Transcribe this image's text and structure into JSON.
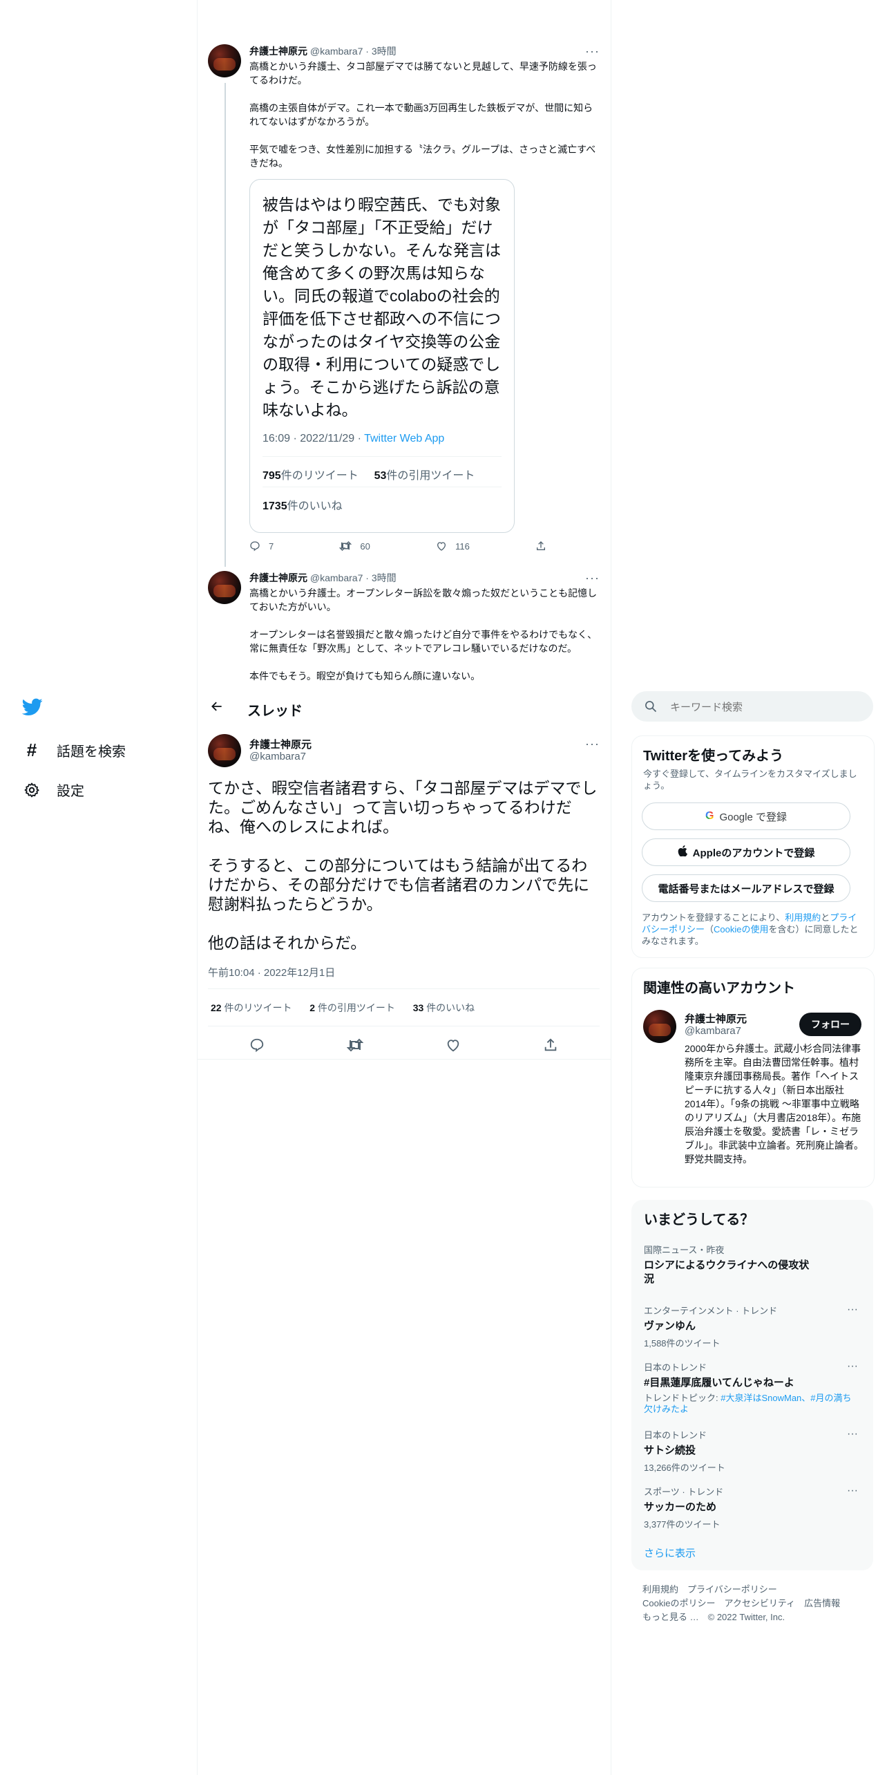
{
  "brand": {
    "accent": "#1d9bf0",
    "text": "#0f1419",
    "muted": "#536471",
    "icon": "twitter-bird-icon"
  },
  "nav": {
    "explore": "話題を検索",
    "settings": "設定"
  },
  "thread_header": {
    "title": "スレッド"
  },
  "tweet1": {
    "name": "弁護士神原元",
    "handle": "@kambara7",
    "sep": "·",
    "time": "3時間",
    "text": "高橋とかいう弁護士、タコ部屋デマでは勝てないと見越して、早速予防線を張ってるわけだ。\n\n高橋の主張自体がデマ。これ一本で動画3万回再生した鉄板デマが、世間に知られてないはずがなかろうが。\n\n平気で嘘をつき、女性差別に加担する〝法クラ〟グループは、さっさと滅亡すべきだね。",
    "quote": {
      "text": "被告はやはり暇空茜氏、でも対象が「タコ部屋」「不正受給」だけだと笑うしかない。そんな発言は俺含めて多くの野次馬は知らない。同氏の報道でcolaboの社会的評価を低下させ都政への不信につながったのはタイヤ交換等の公金の取得・利用についての疑惑でしょう。そこから逃げたら訴訟の意味ないよね。",
      "meta_time": "16:09 · 2022/11/29 · ",
      "meta_source": "Twitter Web App",
      "retweets_n": "795",
      "retweets_label": "件のリツイート",
      "quotes_n": "53",
      "quotes_label": "件の引用ツイート",
      "likes_n": "1735",
      "likes_label": "件のいいね"
    },
    "replies": "7",
    "retweets": "60",
    "likes": "116"
  },
  "tweet2": {
    "name": "弁護士神原元",
    "handle": "@kambara7",
    "sep": "·",
    "time": "3時間",
    "text": "高橋とかいう弁護士。オープンレター訴訟を散々煽った奴だということも記憶しておいた方がいい。\n\nオープンレターは名誉毀損だと散々煽ったけど自分で事件をやるわけでもなく、常に無責任な「野次馬」として、ネットでアレコレ騒いでいるだけなのだ。\n\n本件でもそう。暇空が負けても知らん顔に違いない。"
  },
  "main_tweet": {
    "name": "弁護士神原元",
    "handle": "@kambara7",
    "text": "てかさ、暇空信者諸君すら、「タコ部屋デマはデマでした。ごめんなさい」って言い切っちゃってるわけだね、俺へのレスによれば。\n\nそうすると、この部分についてはもう結論が出てるわけだから、その部分だけでも信者諸君のカンパで先に慰謝料払ったらどうか。\n\n他の話はそれからだ。",
    "timestamp": "午前10:04 · 2022年12月1日",
    "retweets_n": "22",
    "retweets_label": "件のリツイート",
    "quotes_n": "2",
    "quotes_label": "件の引用ツイート",
    "likes_n": "33",
    "likes_label": "件のいいね"
  },
  "search": {
    "placeholder": "キーワード検索"
  },
  "signup": {
    "title": "Twitterを使ってみよう",
    "subtitle": "今すぐ登録して、タイムラインをカスタマイズしましょう。",
    "google": "Google で登録",
    "apple": "Appleのアカウントで登録",
    "phone": "電話番号またはメールアドレスで登録",
    "legal_1": "アカウントを登録することにより、",
    "legal_link1": "利用規約",
    "legal_2": "と",
    "legal_link2": "プライバシーポリシー",
    "legal_3": "（",
    "legal_link3": "Cookieの使用",
    "legal_4": "を含む）に同意したとみなされます。"
  },
  "related": {
    "title": "関連性の高いアカウント",
    "name": "弁護士神原元",
    "handle": "@kambara7",
    "follow": "フォロー",
    "bio": "2000年から弁護士。武蔵小杉合同法律事務所を主宰。自由法曹団常任幹事。植村隆東京弁護団事務局長。著作「ヘイトスピーチに抗する人々」（新日本出版社2014年）。「9条の挑戦 ～非軍事中立戦略のリアリズム」（大月書店2018年）。布施辰治弁護士を敬愛。愛読書「レ・ミゼラブル」。非武装中立論者。死刑廃止論者。野党共闘支持。"
  },
  "trends": {
    "title": "いまどうしてる？",
    "items": [
      {
        "cat": "国際ニュース・昨夜",
        "title": "ロシアによるウクライナへの侵攻状況",
        "sub": ""
      },
      {
        "cat": "エンターテインメント · トレンド",
        "title": "ヴァンゆん",
        "sub": "1,588件のツイート"
      },
      {
        "cat": "日本のトレンド",
        "title": "#目黒蓮厚底履いてんじゃねーよ",
        "sub_prefix": "トレンドトピック: ",
        "sub_link": "#大泉洋はSnowMan、#月の満ち欠けみたよ"
      },
      {
        "cat": "日本のトレンド",
        "title": "サトシ続投",
        "sub": "13,266件のツイート"
      },
      {
        "cat": "スポーツ · トレンド",
        "title": "サッカーのため",
        "sub": "3,377件のツイート"
      }
    ],
    "show_more": "さらに表示"
  },
  "footer": {
    "terms": "利用規約",
    "privacy": "プライバシーポリシー",
    "cookies": "Cookieのポリシー",
    "accessibility": "アクセシビリティ",
    "ads": "広告情報",
    "more": "もっと見る …",
    "copyright": "© 2022 Twitter, Inc."
  }
}
